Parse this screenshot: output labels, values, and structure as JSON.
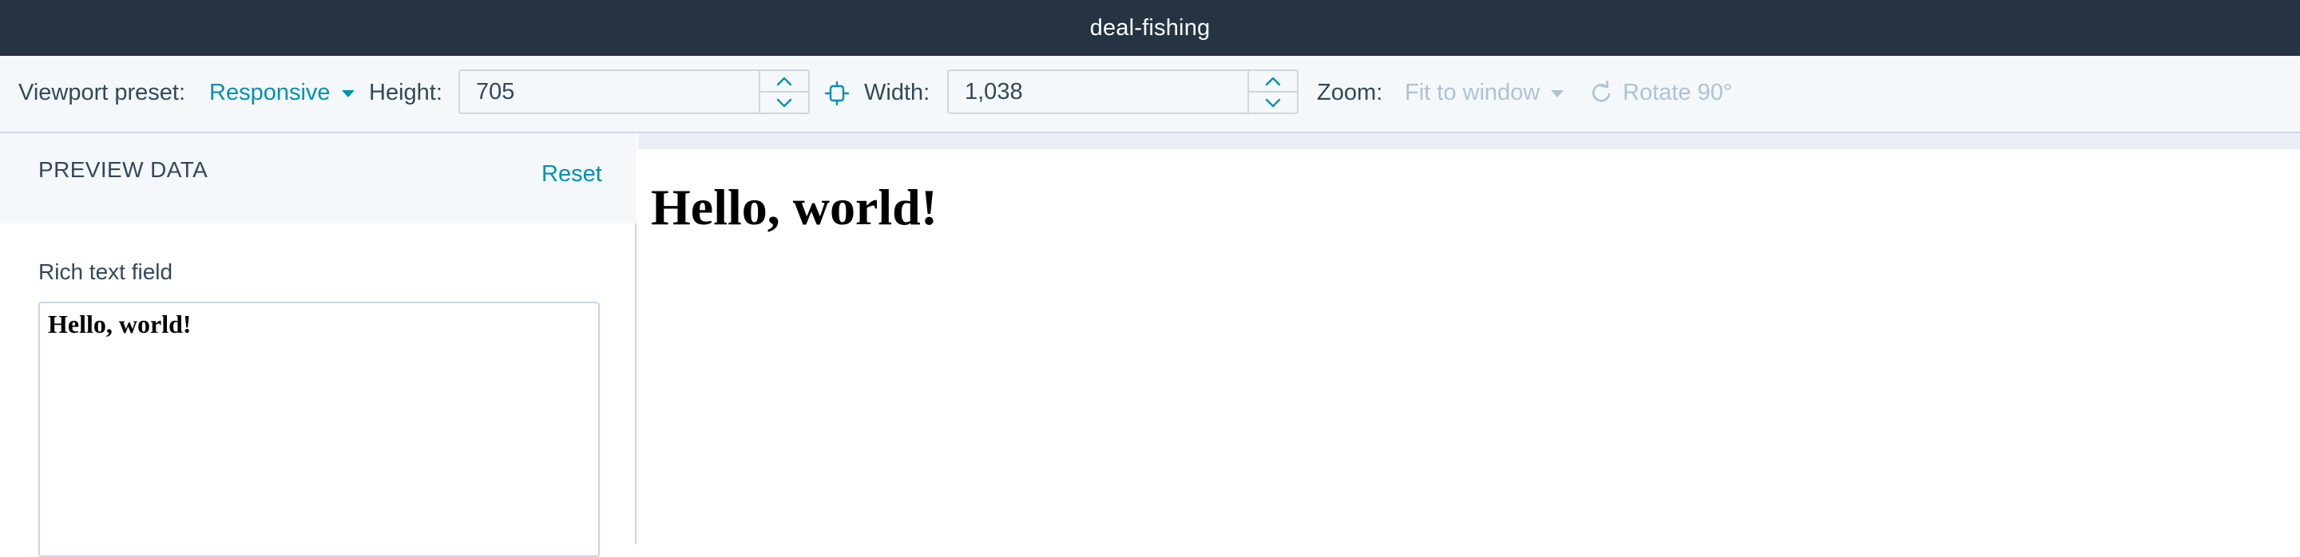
{
  "window": {
    "title": "deal-fishing"
  },
  "toolbar": {
    "viewport_preset_label": "Viewport preset:",
    "viewport_preset_value": "Responsive",
    "height_label": "Height:",
    "height_value": "705",
    "width_label": "Width:",
    "width_value": "1,038",
    "zoom_label": "Zoom:",
    "zoom_value": "Fit to window",
    "rotate_label": "Rotate 90°",
    "icons": {
      "link": "link-icon",
      "rotate": "rotate-icon",
      "chevron_up": "chevron-up-icon",
      "chevron_down": "chevron-down-icon"
    }
  },
  "sidebar": {
    "heading": "PREVIEW DATA",
    "reset_label": "Reset",
    "field_label": "Rich text field",
    "field_value": "Hello, world!"
  },
  "preview": {
    "heading": "Hello, world!"
  },
  "colors": {
    "titlebar_bg": "#253342",
    "accent": "#0091ae",
    "disabled": "#b0c1d4",
    "text": "#33475b",
    "border": "#cbd6e2",
    "panel_bg": "#f5f8fa"
  }
}
